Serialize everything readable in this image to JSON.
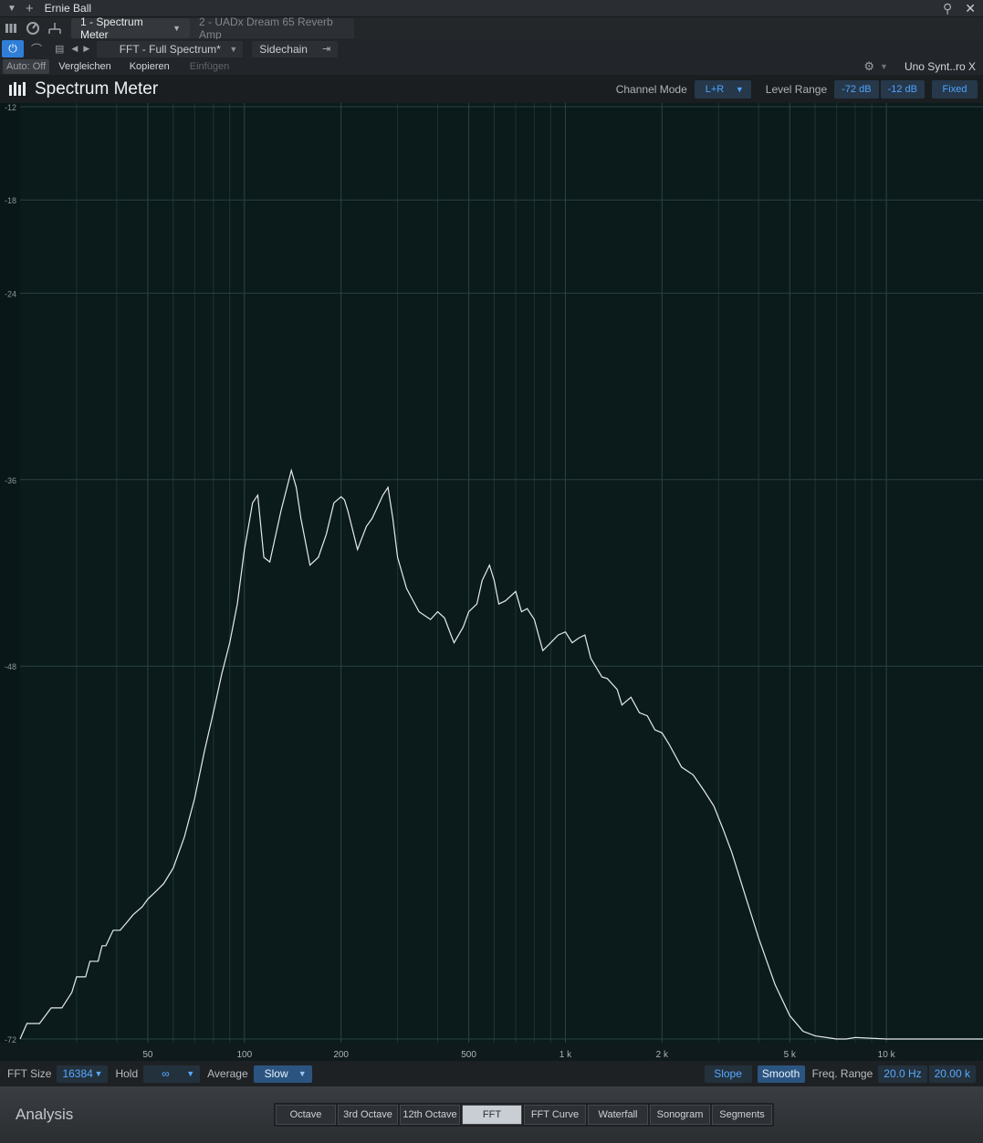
{
  "window": {
    "title": "Ernie Ball"
  },
  "tabs": [
    {
      "label": "1 - Spectrum Meter",
      "active": true
    },
    {
      "label": "2 - UADx Dream 65 Reverb Amp",
      "active": false
    }
  ],
  "preset": {
    "name": "FFT - Full Spectrum*",
    "sidechain_label": "Sidechain"
  },
  "autobar": {
    "auto": "Auto: Off",
    "compare": "Vergleichen",
    "copy": "Kopieren",
    "paste": "Einfügen",
    "device": "Uno Synt..ro X"
  },
  "header": {
    "title": "Spectrum Meter",
    "channel_mode_label": "Channel Mode",
    "channel_mode": "L+R",
    "level_range_label": "Level Range",
    "level_min": "-72 dB",
    "level_max": "-12 dB",
    "fixed": "Fixed"
  },
  "chart_data": {
    "type": "line",
    "xscale": "log",
    "xlim": [
      20,
      20000
    ],
    "ylim": [
      -72,
      -12
    ],
    "y_ticks": [
      "-12",
      "-18",
      "-24",
      "-36",
      "-48",
      "-72"
    ],
    "x_ticks": [
      "50",
      "100",
      "200",
      "500",
      "1 k",
      "2 k",
      "5 k",
      "10 k"
    ],
    "series": [
      {
        "color": "#e6eaec",
        "x": [
          20,
          21,
          23,
          25,
          27,
          29,
          30,
          32,
          33,
          35,
          36,
          37,
          39,
          41,
          43,
          45,
          48,
          50,
          53,
          56,
          60,
          65,
          70,
          75,
          80,
          85,
          90,
          95,
          100,
          103,
          106,
          110,
          115,
          120,
          130,
          140,
          145,
          150,
          160,
          170,
          180,
          190,
          200,
          205,
          210,
          225,
          240,
          250,
          270,
          280,
          290,
          300,
          320,
          350,
          380,
          400,
          420,
          440,
          450,
          480,
          500,
          530,
          550,
          580,
          600,
          620,
          650,
          700,
          730,
          760,
          800,
          850,
          900,
          950,
          1000,
          1050,
          1100,
          1150,
          1200,
          1300,
          1350,
          1450,
          1500,
          1600,
          1700,
          1800,
          1900,
          2000,
          2100,
          2300,
          2500,
          2700,
          2900,
          3100,
          3300,
          3600,
          4000,
          4500,
          5000,
          5500,
          6000,
          7000,
          7500,
          8000,
          10000,
          15000,
          20000
        ],
        "y": [
          -72,
          -71,
          -71,
          -70,
          -70,
          -69,
          -68,
          -68,
          -67,
          -67,
          -66,
          -66,
          -65,
          -65,
          -64.5,
          -64,
          -63.5,
          -63,
          -62.5,
          -62,
          -61,
          -59,
          -56.5,
          -53.5,
          -51,
          -48.5,
          -46.5,
          -44,
          -40.5,
          -39,
          -37.5,
          -37,
          -41,
          -41.3,
          -38,
          -35.4,
          -36.5,
          -38.5,
          -41.5,
          -41,
          -39.5,
          -37.5,
          -37.1,
          -37.3,
          -38,
          -40.5,
          -39,
          -38.5,
          -37,
          -36.5,
          -38.5,
          -41,
          -43,
          -44.5,
          -45,
          -44.5,
          -44.9,
          -46,
          -46.5,
          -45.5,
          -44.5,
          -44,
          -42.5,
          -41.5,
          -42.5,
          -44,
          -43.8,
          -43.2,
          -44.5,
          -44.3,
          -45,
          -47,
          -46.5,
          -46,
          -45.8,
          -46.5,
          -46.2,
          -46,
          -47.5,
          -48.7,
          -48.8,
          -49.5,
          -50.5,
          -50,
          -51,
          -51.2,
          -52.1,
          -52.3,
          -53,
          -54.5,
          -55,
          -56,
          -57,
          -58.5,
          -60,
          -62.5,
          -65.5,
          -68.5,
          -70.5,
          -71.5,
          -71.8,
          -72,
          -72,
          -71.9,
          -72,
          -72,
          -72
        ]
      }
    ]
  },
  "controls": {
    "fft_size_label": "FFT Size",
    "fft_size": "16384",
    "hold_label": "Hold",
    "hold": "∞",
    "average_label": "Average",
    "average": "Slow",
    "slope": "Slope",
    "smooth": "Smooth",
    "freq_range_label": "Freq. Range",
    "freq_min": "20.0 Hz",
    "freq_max": "20.00 k"
  },
  "analysis": {
    "label": "Analysis",
    "modes": [
      {
        "label": "Octave",
        "active": false
      },
      {
        "label": "3rd Octave",
        "active": false
      },
      {
        "label": "12th Octave",
        "active": false
      },
      {
        "label": "FFT",
        "active": true
      },
      {
        "label": "FFT Curve",
        "active": false
      },
      {
        "label": "Waterfall",
        "active": false
      },
      {
        "label": "Sonogram",
        "active": false
      },
      {
        "label": "Segments",
        "active": false
      }
    ]
  }
}
